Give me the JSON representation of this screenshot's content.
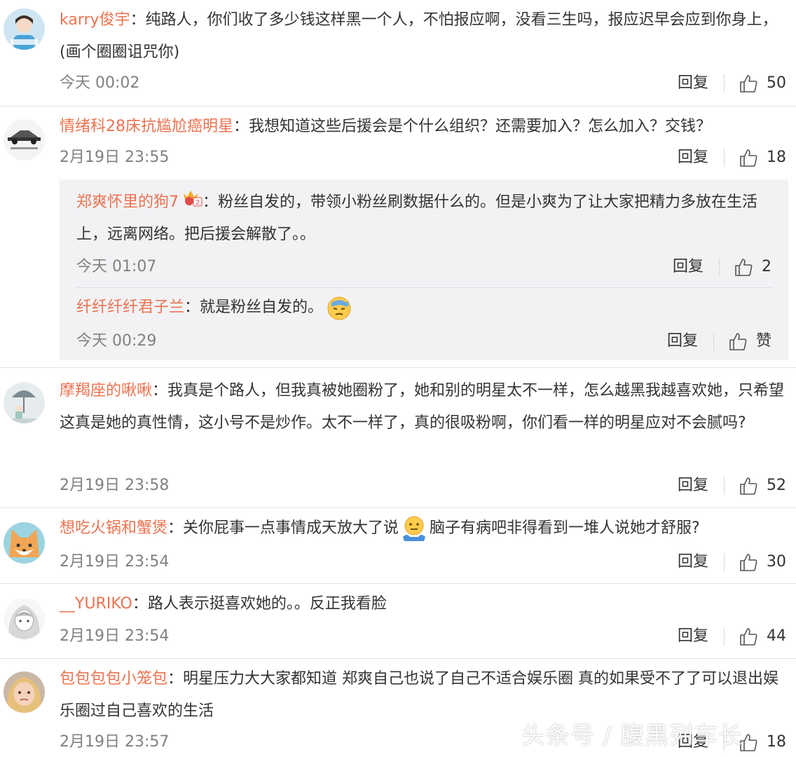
{
  "comments": [
    {
      "user": "karry俊宇",
      "text": "纯路人，你们收了多少钱这样黑一个人，不怕报应啊，没看三生吗，报应迟早会应到你身上，(画个圈圈诅咒你)",
      "time": "今天 00:02",
      "reply_label": "回复",
      "likes": "50"
    },
    {
      "user": "情绪科28床抗尴尬癌明星",
      "text": "我想知道这些后援会是个什么组织？还需要加入？怎么加入？交钱？",
      "time": "2月19日 23:55",
      "reply_label": "回复",
      "likes": "18",
      "replies": [
        {
          "user": "郑爽怀里的狗7",
          "text": "粉丝自发的，带领小粉丝刷数据什么的。但是小爽为了让大家把精力多放在生活上，远离网络。把后援会解散了。。",
          "time": "今天 01:07",
          "reply_label": "回复",
          "likes": "2"
        },
        {
          "user": "纤纤纤纤君子兰",
          "text": "就是粉丝自发的。",
          "time": "今天 00:29",
          "reply_label": "回复",
          "likes": "赞"
        }
      ]
    },
    {
      "user": "摩羯座的啾啾",
      "text": "我真是个路人，但我真被她圈粉了，她和别的明星太不一样，怎么越黑我越喜欢她，只希望这真是她的真性情，这小号不是炒作。太不一样了，真的很吸粉啊，你们看一样的明星应对不会腻吗?",
      "time": "2月19日 23:58",
      "reply_label": "回复",
      "likes": "52"
    },
    {
      "user": "想吃火锅和蟹煲",
      "text_a": "关你屁事一点事情成天放大了说",
      "text_b": "脑子有病吧非得看到一堆人说她才舒服?",
      "time": "2月19日 23:54",
      "reply_label": "回复",
      "likes": "30"
    },
    {
      "user": "__YURIKO",
      "text": "路人表示挺喜欢她的。。反正我看脸",
      "time": "2月19日 23:54",
      "reply_label": "回复",
      "likes": "44"
    },
    {
      "user": "包包包包小笼包",
      "text": "明星压力大大家都知道 郑爽自己也说了自己不适合娱乐圈 真的如果受不了了可以退出娱乐圈过自己喜欢的生活",
      "time": "2月19日 23:57",
      "reply_label": "回复",
      "likes": "18"
    }
  ],
  "watermark": "头条号 / 腹黑列车长",
  "colors": {
    "username": "#eb7350",
    "text": "#333333",
    "meta": "#808080",
    "divider": "#e3e3e3",
    "subbox": "#f2f2f5"
  }
}
